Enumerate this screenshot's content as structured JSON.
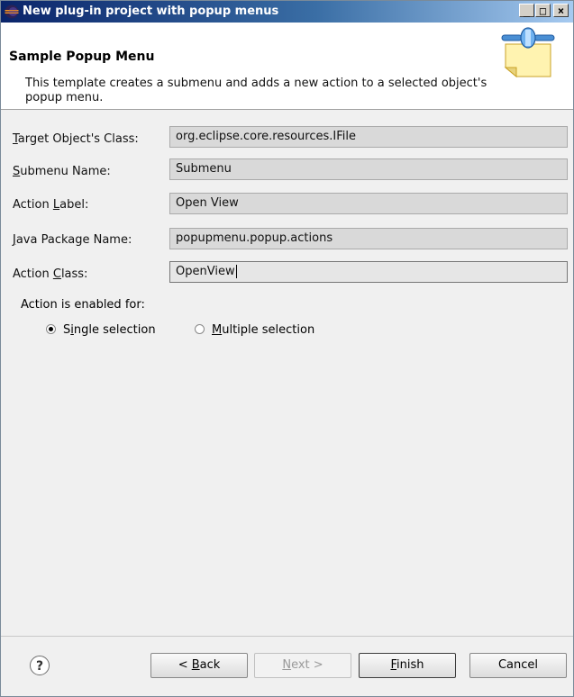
{
  "window": {
    "title": "New plug-in project with popup menus"
  },
  "banner": {
    "heading": "Sample Popup Menu",
    "description": "This template creates a submenu and adds a new action to a selected object's popup menu."
  },
  "form": {
    "rows": [
      {
        "label": "Target Object's Class:",
        "mnemonic_index": 0,
        "value": "org.eclipse.core.resources.IFile"
      },
      {
        "label": "Submenu Name:",
        "mnemonic_index": 0,
        "value": "Submenu"
      },
      {
        "label": "Action Label:",
        "mnemonic_index": 7,
        "value": "Open View"
      },
      {
        "label": "Java Package Name:",
        "mnemonic_index": 0,
        "value": "popupmenu.popup.actions"
      },
      {
        "label": "Action Class:",
        "mnemonic_index": 7,
        "value": "OpenView"
      }
    ],
    "enabled_for_label": "Action is enabled for:",
    "radios": [
      {
        "label": "Single selection",
        "mnemonic_index": 1,
        "selected": true
      },
      {
        "label": "Multiple selection",
        "mnemonic_index": 0,
        "selected": false
      }
    ]
  },
  "buttons": {
    "back": "< Back",
    "next": "Next >",
    "finish": "Finish",
    "cancel": "Cancel",
    "help_glyph": "?"
  },
  "colors": {
    "titlebar_start": "#0a246a",
    "titlebar_end": "#a6caf0",
    "field_bg": "#d9d9d9"
  },
  "icons": [
    "eclipse-app-icon",
    "plugin-wizard-icon",
    "help-icon"
  ]
}
